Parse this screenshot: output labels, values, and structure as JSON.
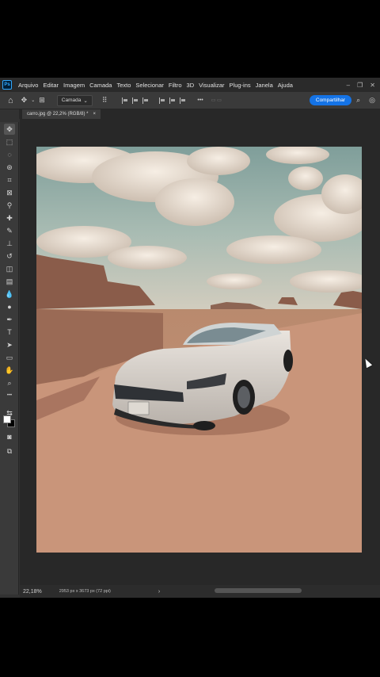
{
  "menubar": {
    "app_icon": "Ps",
    "items": [
      "Arquivo",
      "Editar",
      "Imagem",
      "Camada",
      "Texto",
      "Selecionar",
      "Filtro",
      "3D",
      "Visualizar",
      "Plug-ins",
      "Janela",
      "Ajuda"
    ],
    "window_controls": [
      "–",
      "❐",
      "✕"
    ]
  },
  "options_bar": {
    "home_icon": "home-icon",
    "move_icon": "move-tool-icon",
    "layer_select_value": "Camada",
    "share_label": "Compartilhar",
    "more_glyph": "•••"
  },
  "tab": {
    "title": "carro.jpg @ 22,2% (RGB/8) *",
    "close": "×"
  },
  "toolbar": {
    "tools": [
      {
        "name": "move-tool-icon",
        "glyph": "✥"
      },
      {
        "name": "marquee-tool-icon",
        "glyph": "⬚"
      },
      {
        "name": "lasso-tool-icon",
        "glyph": "◌"
      },
      {
        "name": "quick-select-tool-icon",
        "glyph": "⊛"
      },
      {
        "name": "crop-tool-icon",
        "glyph": "⌗"
      },
      {
        "name": "frame-tool-icon",
        "glyph": "⊠"
      },
      {
        "name": "eyedropper-tool-icon",
        "glyph": "⚲"
      },
      {
        "name": "healing-brush-tool-icon",
        "glyph": "✚"
      },
      {
        "name": "brush-tool-icon",
        "glyph": "✎"
      },
      {
        "name": "stamp-tool-icon",
        "glyph": "⊥"
      },
      {
        "name": "history-brush-tool-icon",
        "glyph": "↺"
      },
      {
        "name": "eraser-tool-icon",
        "glyph": "◫"
      },
      {
        "name": "gradient-tool-icon",
        "glyph": "▤"
      },
      {
        "name": "blur-tool-icon",
        "glyph": "💧"
      },
      {
        "name": "dodge-tool-icon",
        "glyph": "●"
      },
      {
        "name": "pen-tool-icon",
        "glyph": "✒"
      },
      {
        "name": "type-tool-icon",
        "glyph": "T"
      },
      {
        "name": "path-select-tool-icon",
        "glyph": "➤"
      },
      {
        "name": "shape-tool-icon",
        "glyph": "▭"
      },
      {
        "name": "hand-tool-icon",
        "glyph": "✋"
      },
      {
        "name": "zoom-tool-icon",
        "glyph": "⌕"
      },
      {
        "name": "more-tools-icon",
        "glyph": "•••"
      },
      {
        "name": "swap-colors-icon",
        "glyph": "⇆"
      },
      {
        "name": "quick-mask-icon",
        "glyph": "◙"
      },
      {
        "name": "screen-mode-icon",
        "glyph": "⧉"
      }
    ],
    "foreground_color": "#ffffff",
    "background_color": "#000000"
  },
  "status": {
    "zoom": "22,18%",
    "dimensions": "2953 px x 3673 px (72 ppi)",
    "arrow": "›"
  },
  "colors": {
    "share_button": "#1473e6",
    "app_background": "#323232"
  }
}
